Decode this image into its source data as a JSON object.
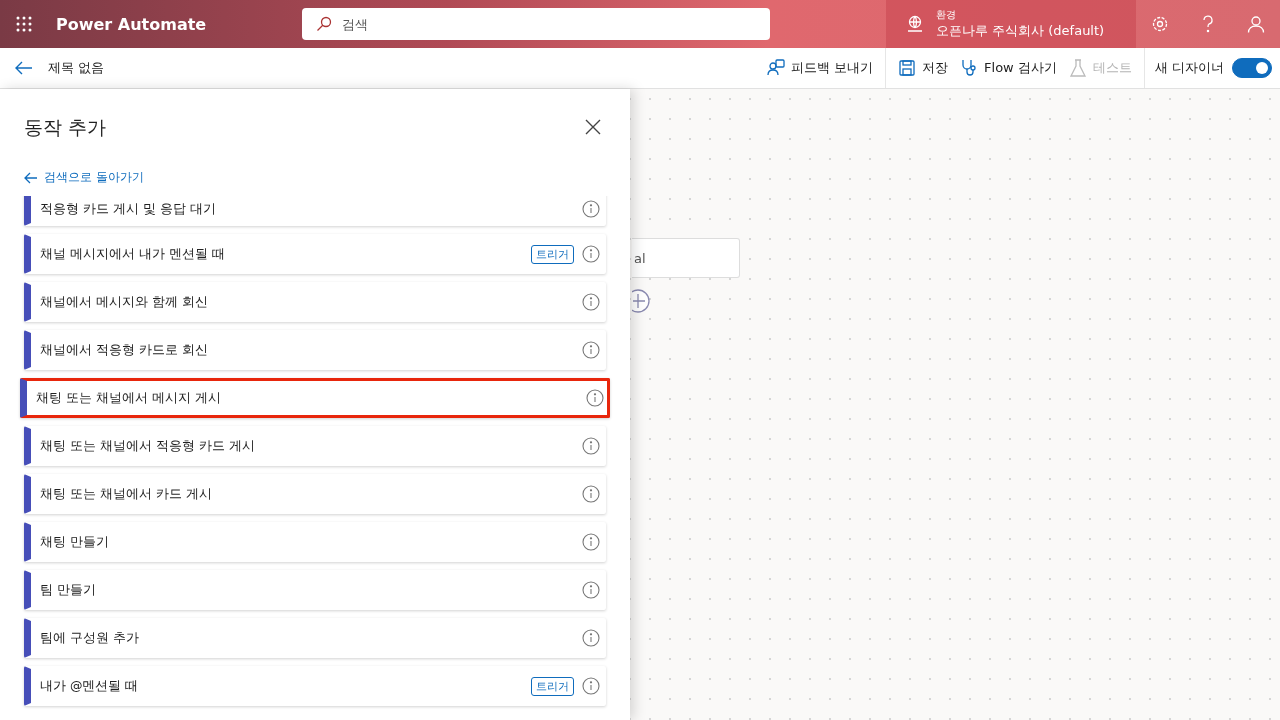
{
  "header": {
    "app_name": "Power Automate",
    "search": {
      "placeholder": "검색"
    },
    "environment": {
      "label": "환경",
      "name": "오픈나루 주식회사 (default)"
    }
  },
  "toolbar": {
    "back_title": "제목 없음",
    "actions": [
      {
        "label": "피드백 보내기",
        "disabled": false,
        "kind": "feedback"
      },
      {
        "label": "저장",
        "disabled": false,
        "kind": "save"
      },
      {
        "label": "Flow 검사기",
        "disabled": false,
        "kind": "checker"
      },
      {
        "label": "테스트",
        "disabled": true,
        "kind": "test"
      }
    ],
    "new_designer": {
      "label": "새 디자이너",
      "on": true
    }
  },
  "canvas": {
    "card_text": "al"
  },
  "panel": {
    "title": "동작 추가",
    "back_link": "검색으로 돌아가기",
    "items": [
      {
        "label": "적응형 카드 게시 및 응답 대기",
        "selected": false
      },
      {
        "label": "채널 메시지에서 내가 멘션될 때",
        "badge": "트리거",
        "selected": false
      },
      {
        "label": "채널에서 메시지와 함께 회신",
        "selected": false
      },
      {
        "label": "채널에서 적응형 카드로 회신",
        "selected": false
      },
      {
        "label": "채팅 또는 채널에서 메시지 게시",
        "selected": true
      },
      {
        "label": "채팅 또는 채널에서 적응형 카드 게시",
        "selected": false
      },
      {
        "label": "채팅 또는 채널에서 카드 게시",
        "selected": false
      },
      {
        "label": "채팅 만들기",
        "selected": false
      },
      {
        "label": "팀 만들기",
        "selected": false
      },
      {
        "label": "팀에 구성원 추가",
        "selected": false
      },
      {
        "label": "내가 @멘션될 때",
        "badge": "트리거",
        "selected": false
      }
    ]
  }
}
